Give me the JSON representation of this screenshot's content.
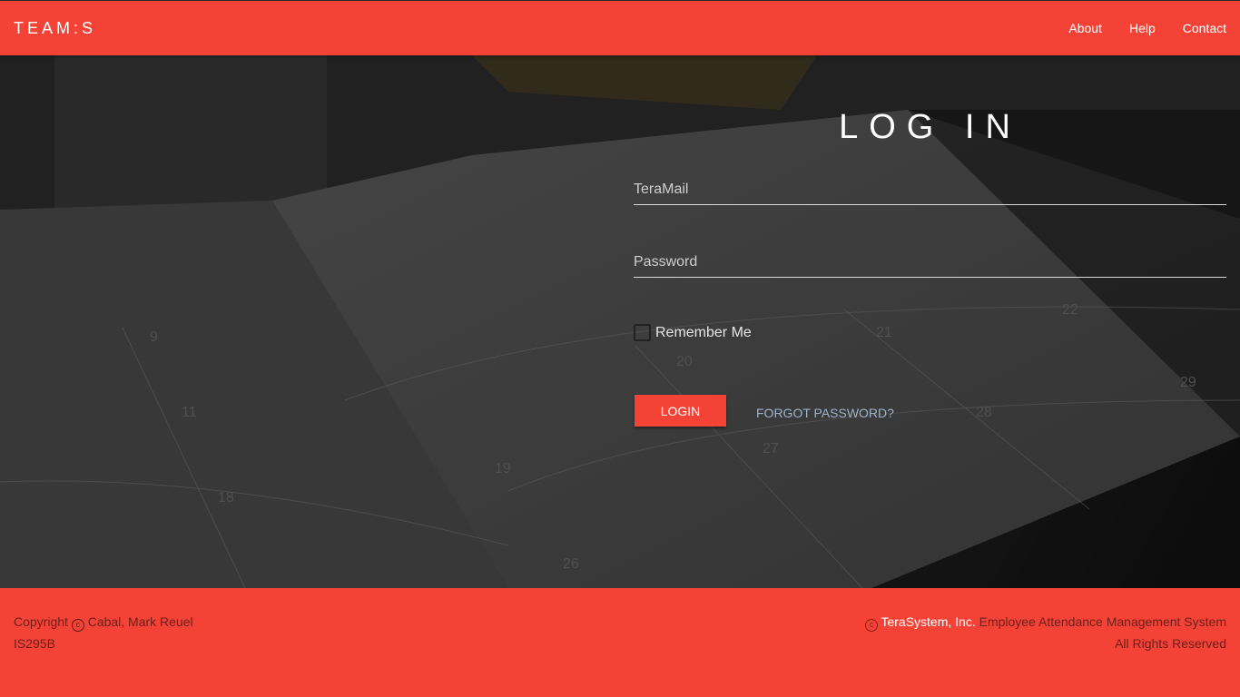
{
  "navbar": {
    "brand": "TEAM:S",
    "links": [
      "About",
      "Help",
      "Contact"
    ]
  },
  "login": {
    "title": "LOG IN",
    "email_placeholder": "TeraMail",
    "password_placeholder": "Password",
    "remember_label": "Remember Me",
    "login_button": "LOGIN",
    "forgot_link": "FORGOT PASSWORD?"
  },
  "footer": {
    "copyright_prefix": "Copyright",
    "author": "Cabal, Mark Reuel",
    "course": "IS295B",
    "company": "TeraSystem, Inc.",
    "system_name": "Employee Attendance Management System",
    "rights": "All Rights Reserved"
  },
  "colors": {
    "accent": "#f44336",
    "footer_text": "#6b1f1a",
    "link_muted": "#9fb3c8"
  },
  "icons": {
    "copyright": "copyright-icon"
  }
}
